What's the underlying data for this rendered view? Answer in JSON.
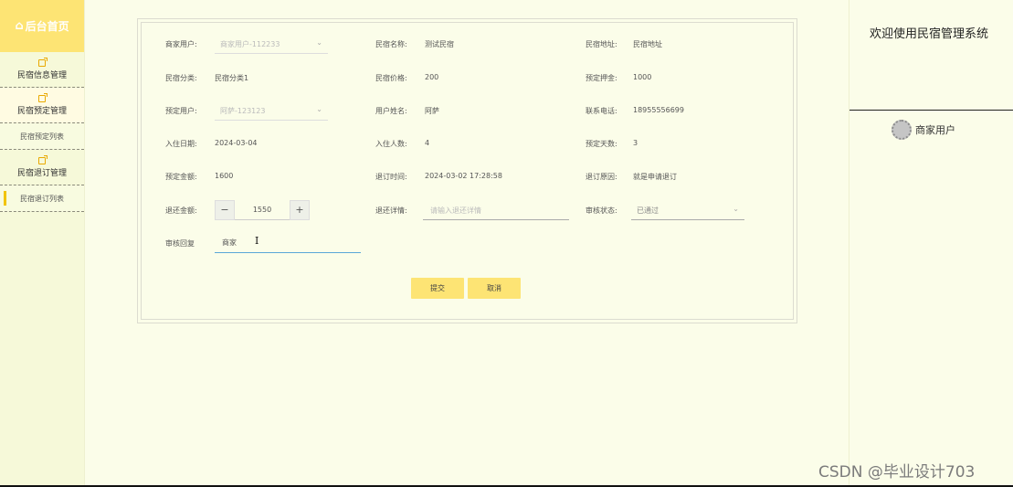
{
  "sidebar": {
    "brand": "后台首页",
    "items": [
      {
        "label": "民宿信息管理",
        "type": "group"
      },
      {
        "label": "民宿预定管理",
        "type": "group"
      },
      {
        "label": "民宿预定列表",
        "type": "sub"
      },
      {
        "label": "民宿退订管理",
        "type": "group"
      },
      {
        "label": "民宿退订列表",
        "type": "sub",
        "active": true
      }
    ]
  },
  "form": {
    "merchant_user": {
      "label": "商家用户:",
      "value": "商家用户-112233"
    },
    "homestay_name": {
      "label": "民宿名称:",
      "value": "测试民宿"
    },
    "homestay_address": {
      "label": "民宿地址:",
      "value": "民宿地址"
    },
    "homestay_category": {
      "label": "民宿分类:",
      "value": "民宿分类1"
    },
    "homestay_price": {
      "label": "民宿价格:",
      "value": "200"
    },
    "deposit": {
      "label": "预定押金:",
      "value": "1000"
    },
    "booking_user": {
      "label": "预定用户:",
      "value": "阿萨-123123"
    },
    "user_name": {
      "label": "用户姓名:",
      "value": "阿萨"
    },
    "phone": {
      "label": "联系电话:",
      "value": "18955556699"
    },
    "checkin_date": {
      "label": "入住日期:",
      "value": "2024-03-04"
    },
    "guests": {
      "label": "入住人数:",
      "value": "4"
    },
    "days": {
      "label": "预定天数:",
      "value": "3"
    },
    "booking_amount": {
      "label": "预定金额:",
      "value": "1600"
    },
    "cancel_time": {
      "label": "退订时间:",
      "value": "2024-03-02 17:28:58"
    },
    "cancel_reason": {
      "label": "退订原因:",
      "value": "就是申请退订"
    },
    "refund_amount": {
      "label": "退还金额:",
      "value": "1550",
      "minus": "−",
      "plus": "+"
    },
    "refund_detail": {
      "label": "退还详情:",
      "placeholder": "请输入退还详情"
    },
    "review_status": {
      "label": "审核状态:",
      "value": "已通过"
    },
    "review_reply": {
      "label": "审核回复",
      "value": "商家"
    },
    "submit": "提交",
    "cancel": "取消"
  },
  "right": {
    "welcome": "欢迎使用民宿管理系统",
    "user": "商家用户"
  },
  "watermark": "CSDN @毕业设计703"
}
